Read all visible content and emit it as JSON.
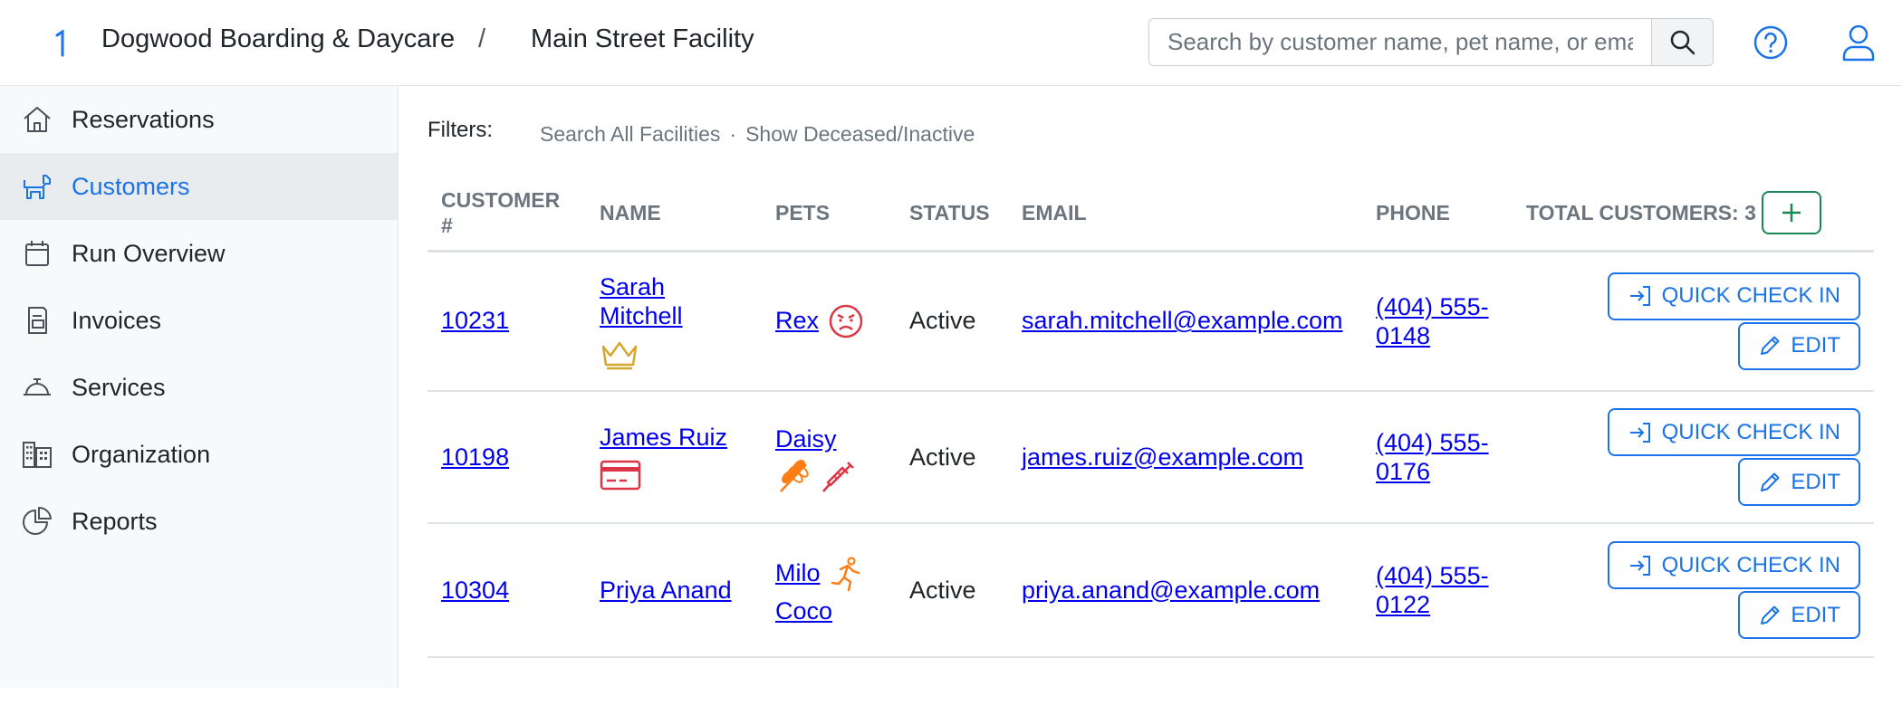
{
  "header": {
    "org_name": "Dogwood Boarding & Daycare",
    "separator": "/",
    "facility": "Main Street Facility",
    "search_placeholder": "Search by customer name, pet name, or email"
  },
  "sidebar": {
    "items": [
      {
        "label": "Reservations",
        "icon": "house-icon"
      },
      {
        "label": "Customers",
        "icon": "dog-icon"
      },
      {
        "label": "Run Overview",
        "icon": "calendar-icon"
      },
      {
        "label": "Invoices",
        "icon": "receipt-icon"
      },
      {
        "label": "Services",
        "icon": "bell-icon"
      },
      {
        "label": "Organization",
        "icon": "building-icon"
      },
      {
        "label": "Reports",
        "icon": "pie-chart-icon"
      }
    ],
    "active_index": 1
  },
  "filters": {
    "label": "Filters:",
    "search_all": "Search All Facilities",
    "dot": "·",
    "show_deceased": "Show Deceased/Inactive"
  },
  "table": {
    "headers": {
      "customer": "CUSTOMER #",
      "name": "NAME",
      "pets": "PETS",
      "status": "STATUS",
      "email": "EMAIL",
      "phone": "PHONE",
      "total": "TOTAL CUSTOMERS: 3"
    },
    "rows": [
      {
        "customer_no": "10231",
        "name": "Sarah Mitchell",
        "name_icons": [
          "crown-icon"
        ],
        "pets": [
          {
            "name": "Rex",
            "icons": [
              "angry-face-icon"
            ]
          }
        ],
        "status": "Active",
        "email": "sarah.mitchell@example.com",
        "phone": "(404) 555-0148"
      },
      {
        "customer_no": "10198",
        "name": "James Ruiz",
        "name_icons": [
          "credit-card-icon"
        ],
        "pets": [
          {
            "name": "Daisy",
            "icons": [
              "wheat-icon",
              "syringe-icon"
            ]
          }
        ],
        "status": "Active",
        "email": "james.ruiz@example.com",
        "phone": "(404) 555-0176"
      },
      {
        "customer_no": "10304",
        "name": "Priya Anand",
        "name_icons": [],
        "pets": [
          {
            "name": "Milo",
            "icons": [
              "running-icon"
            ]
          },
          {
            "name": "Coco",
            "icons": []
          }
        ],
        "status": "Active",
        "email": "priya.anand@example.com",
        "phone": "(404) 555-0122"
      }
    ],
    "quick_check_in_label": "QUICK CHECK IN",
    "edit_label": "EDIT"
  },
  "colors": {
    "accent": "#1a73e8",
    "success": "#198754",
    "crown": "#d4a72c",
    "alert": "#dc3545",
    "warning": "#fd7e14"
  }
}
